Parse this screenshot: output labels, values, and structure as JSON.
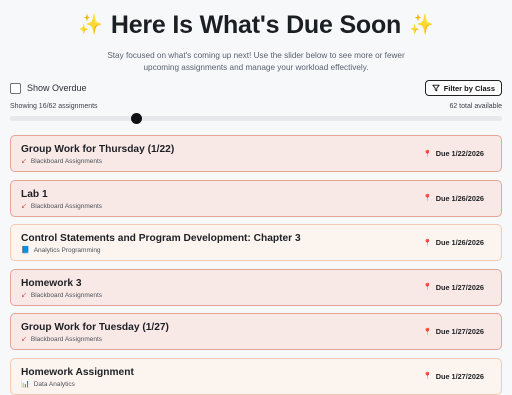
{
  "header": {
    "title": "Here Is What's Due Soon",
    "sparkle": "✨",
    "subtitle": "Stay focused on what's coming up next! Use the slider below to see more or fewer upcoming assignments and manage your workload effectively."
  },
  "controls": {
    "show_overdue_label": "Show Overdue",
    "show_overdue_checked": false,
    "filter_button_label": "Filter by Class",
    "showing_text": "Showing 16/62 assignments",
    "total_text": "62 total available",
    "slider_value": 16,
    "slider_max": 62
  },
  "assignments": [
    {
      "title": "Group Work for Thursday (1/22)",
      "course": "Blackboard Assignments",
      "course_icon": "↙",
      "due": "Due 1/22/2026"
    },
    {
      "title": "Lab 1",
      "course": "Blackboard Assignments",
      "course_icon": "↙",
      "due": "Due 1/26/2026"
    },
    {
      "title": "Control Statements and Program Development: Chapter 3",
      "course": "Analytics Programming",
      "course_icon": "📘",
      "due": "Due 1/26/2026"
    },
    {
      "title": "Homework 3",
      "course": "Blackboard Assignments",
      "course_icon": "↙",
      "due": "Due 1/27/2026"
    },
    {
      "title": "Group Work for Tuesday (1/27)",
      "course": "Blackboard Assignments",
      "course_icon": "↙",
      "due": "Due 1/27/2026"
    },
    {
      "title": "Homework Assignment",
      "course": "Data Analytics",
      "course_icon": "📊",
      "due": "Due 1/27/2026"
    }
  ],
  "colors": {
    "card_urgent_bg": "#f9e9e6",
    "card_urgent_border": "#e6a39a",
    "card_light_bg": "#fcf4ee",
    "card_light_border": "#efcab5",
    "blackboard_icon": "#d9534f"
  },
  "icons": {
    "due": "pin-icon",
    "filter": "filter-icon"
  }
}
